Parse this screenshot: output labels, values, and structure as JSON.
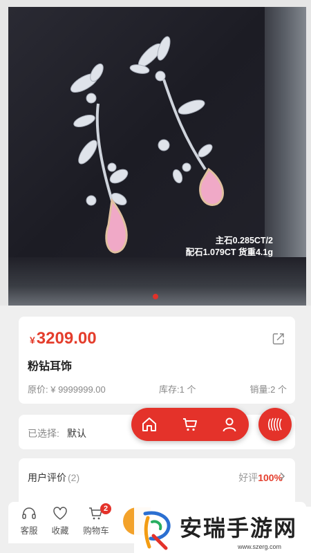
{
  "hero": {
    "spec_line1": "主石0.285CT/2",
    "spec_line2": "配石1.079CT 货重4.1g",
    "carousel_active_index": 0
  },
  "product": {
    "currency": "¥",
    "price": "3209.00",
    "name": "粉钻耳饰",
    "original_price": "原价: ¥ 9999999.00",
    "stock": "库存:1 个",
    "sales": "销量:2 个"
  },
  "selection": {
    "label": "已选择:",
    "value": "默认"
  },
  "reviews": {
    "title": "用户评价",
    "count": "(2)",
    "good_label": "好评",
    "good_percent": "100%"
  },
  "float_nav": {
    "items": [
      "home-icon",
      "cart-icon",
      "user-icon"
    ],
    "toggle_icon": "waves-icon"
  },
  "bottom_bar": {
    "service_label": "客服",
    "favorite_label": "收藏",
    "cart_label": "购物车",
    "cart_badge": "2"
  },
  "watermark": {
    "title": "安瑞手游网",
    "url": "www.szerg.com"
  },
  "colors": {
    "accent": "#e4322a",
    "price": "#e43d2c",
    "action_orange": "#f3a22a"
  }
}
